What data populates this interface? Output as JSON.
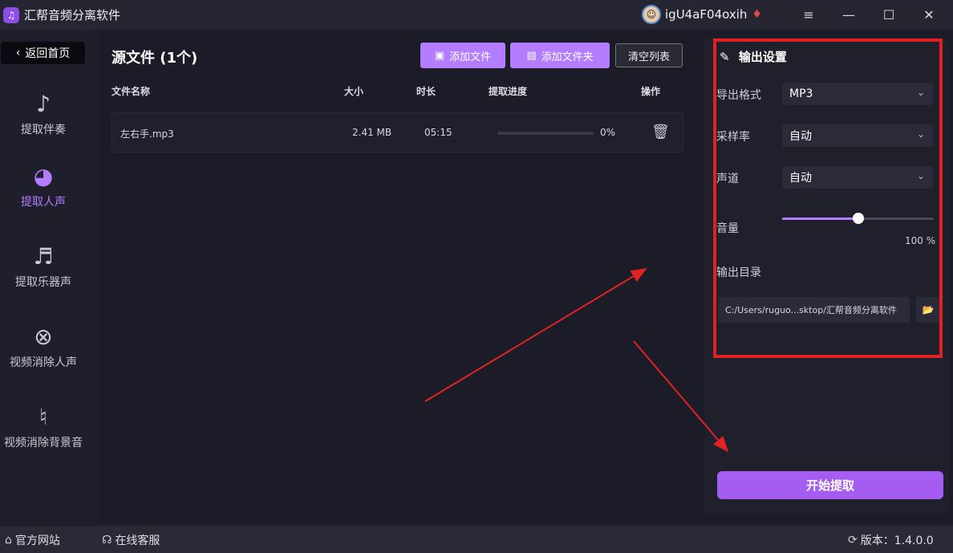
{
  "app": {
    "title": "汇帮音频分离软件",
    "username": "igU4aF04oxih"
  },
  "sidebar": {
    "back_label": "返回首页",
    "items": [
      {
        "label": "提取伴奏",
        "icon": "music-note-icon"
      },
      {
        "label": "提取人声",
        "icon": "voice-icon"
      },
      {
        "label": "提取乐器声",
        "icon": "guitar-icon"
      },
      {
        "label": "视频消除人声",
        "icon": "user-remove-icon"
      },
      {
        "label": "视频消除背景音",
        "icon": "music-off-icon"
      }
    ],
    "active_index": 1
  },
  "main": {
    "title": "源文件 (1个)",
    "add_file_label": "添加文件",
    "add_folder_label": "添加文件夹",
    "clear_label": "清空列表",
    "columns": [
      "文件名称",
      "大小",
      "时长",
      "提取进度",
      "操作"
    ],
    "files": [
      {
        "name": "左右手.mp3",
        "size": "2.41 MB",
        "duration": "05:15",
        "progress_text": "0%",
        "progress": 0
      }
    ]
  },
  "settings": {
    "title": "输出设置",
    "format_label": "导出格式",
    "format_value": "MP3",
    "rate_label": "采样率",
    "rate_value": "自动",
    "channel_label": "声道",
    "channel_value": "自动",
    "volume_label": "音量",
    "volume_text": "100 %",
    "volume_level": 0.5,
    "dir_label": "输出目录",
    "dir_value": "C:/Users/ruguo...sktop/汇帮音频分离软件",
    "start_label": "开始提取"
  },
  "footer": {
    "website": "官方网站",
    "support": "在线客服",
    "version": "版本：1.4.0.0"
  },
  "colors": {
    "accent": "#b47cff",
    "start_button": "#a55cf0",
    "highlight_box": "#e02222"
  }
}
